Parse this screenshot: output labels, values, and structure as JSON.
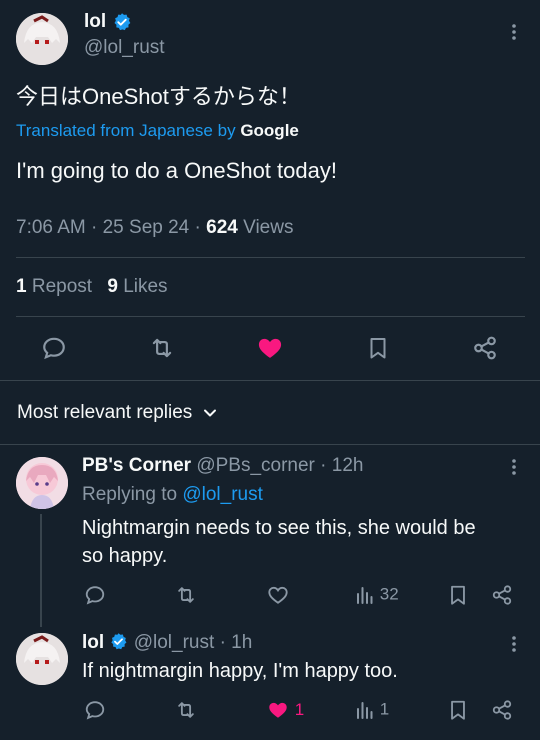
{
  "tweet": {
    "author": {
      "name": "lol",
      "handle": "@lol_rust"
    },
    "text": "今日はOneShotするからな！",
    "translated_prefix": "Translated from Japanese",
    "translated_by": "by",
    "google": "Google",
    "translation": "I'm going to do a OneShot today!",
    "time": "7:06 AM",
    "sep1": "·",
    "date": "25 Sep 24",
    "sep2": "·",
    "views_count": "624",
    "views_label": "Views",
    "reposts_count": "1",
    "reposts_label": "Repost",
    "likes_count": "9",
    "likes_label": "Likes"
  },
  "sort": {
    "label": "Most relevant replies"
  },
  "replies": [
    {
      "name": "PB's Corner",
      "handle": "@PBs_corner",
      "sep": "·",
      "time": "12h",
      "replying_prefix": "Replying to",
      "replying_to": "@lol_rust",
      "text_line1": "Nightmargin needs to see this, she would be",
      "text_line2": "so happy.",
      "views": "32",
      "likes": ""
    },
    {
      "name": "lol",
      "handle": "@lol_rust",
      "sep": "·",
      "time": "1h",
      "text": "If nightmargin happy, I'm happy too.",
      "likes": "1",
      "views": "1"
    }
  ],
  "colors": {
    "bg": "#15202b",
    "accent": "#1d9bf0",
    "like": "#f91880",
    "muted": "#8b98a5",
    "divider": "#38444d"
  },
  "icons": [
    "more-icon",
    "verified-badge-icon",
    "reply-icon",
    "repost-icon",
    "like-icon",
    "bookmark-icon",
    "share-icon",
    "views-icon",
    "chevron-down-icon"
  ]
}
